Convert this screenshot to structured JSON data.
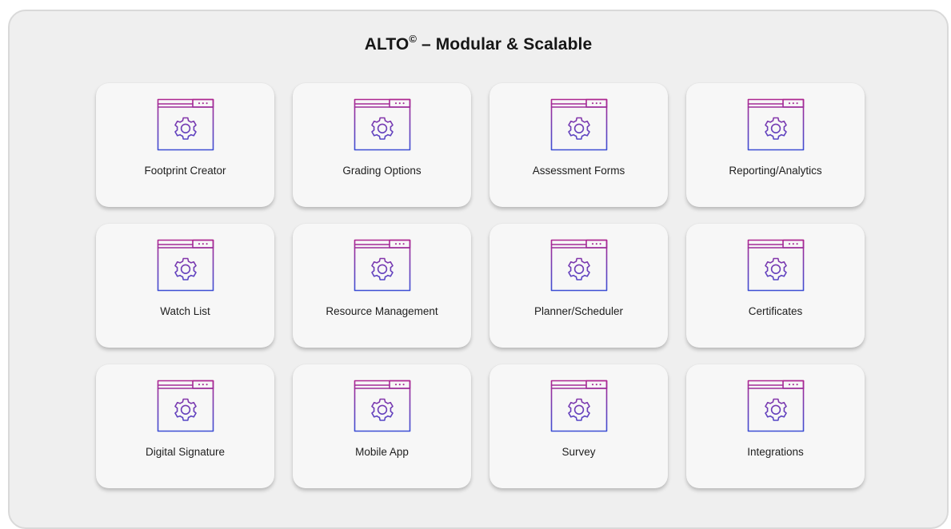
{
  "header": {
    "title_main": "ALTO",
    "title_sup": "©",
    "title_rest": " – Modular & Scalable"
  },
  "colors": {
    "icon_gradient_top": "#b0268f",
    "icon_gradient_bottom": "#3a4fd6",
    "panel_background": "#efefef",
    "card_background": "#f7f7f7"
  },
  "modules": [
    {
      "label": "Footprint Creator",
      "icon": "settings-window-icon"
    },
    {
      "label": "Grading Options",
      "icon": "settings-window-icon"
    },
    {
      "label": "Assessment Forms",
      "icon": "settings-window-icon"
    },
    {
      "label": "Reporting/Analytics",
      "icon": "settings-window-icon"
    },
    {
      "label": "Watch List",
      "icon": "settings-window-icon"
    },
    {
      "label": "Resource Management",
      "icon": "settings-window-icon"
    },
    {
      "label": "Planner/Scheduler",
      "icon": "settings-window-icon"
    },
    {
      "label": "Certificates",
      "icon": "settings-window-icon"
    },
    {
      "label": "Digital Signature",
      "icon": "settings-window-icon"
    },
    {
      "label": "Mobile App",
      "icon": "settings-window-icon"
    },
    {
      "label": "Survey",
      "icon": "settings-window-icon"
    },
    {
      "label": "Integrations",
      "icon": "settings-window-icon"
    }
  ]
}
